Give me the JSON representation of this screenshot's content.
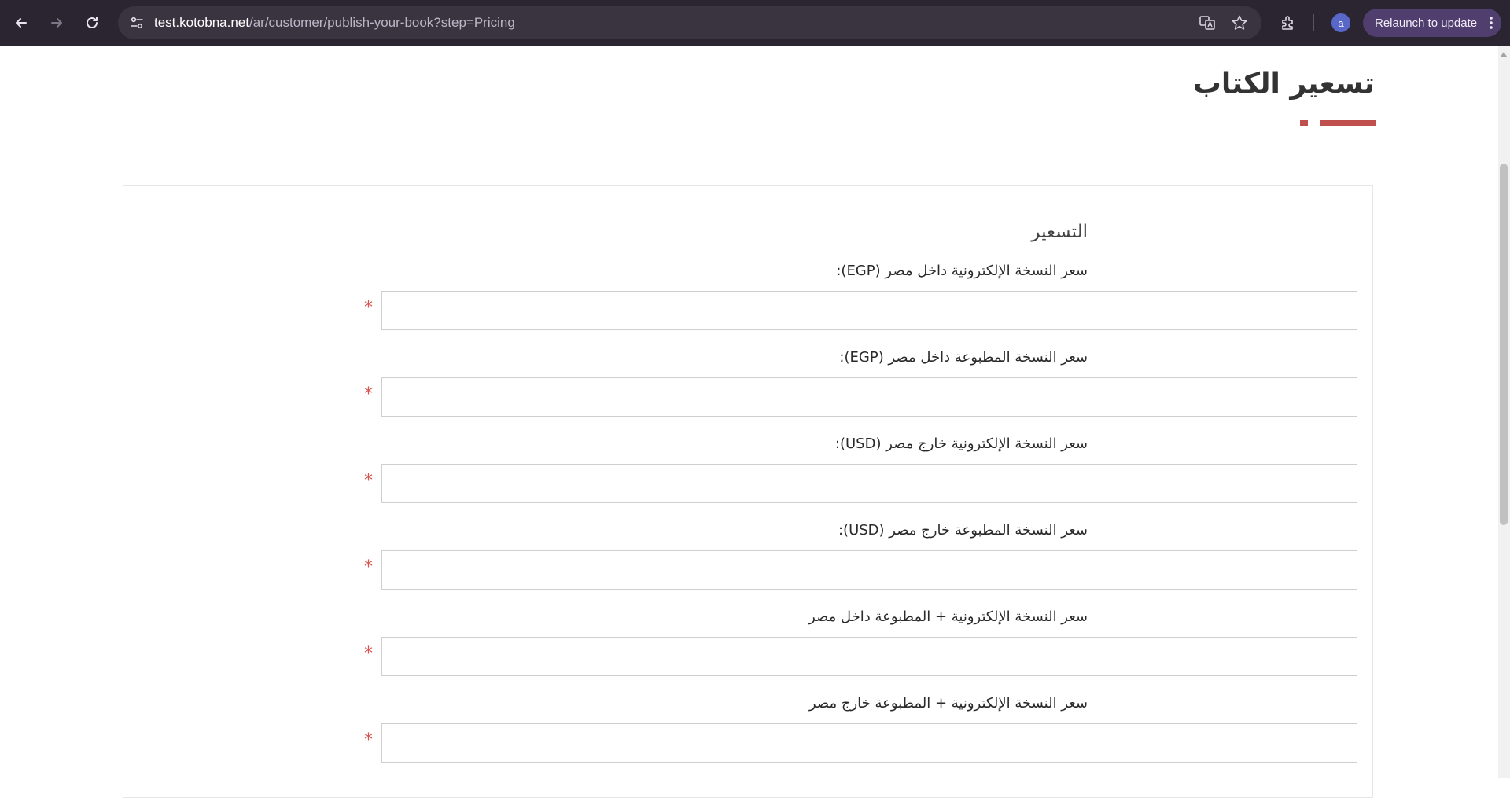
{
  "browser": {
    "url_host": "test.kotobna.net",
    "url_path": "/ar/customer/publish-your-book?step=Pricing",
    "avatar_letter": "a",
    "relaunch_label": "Relaunch to update"
  },
  "page": {
    "title": "تسعير الكتاب",
    "accent_color": "#c0504d",
    "section_title": "التسعير",
    "required_mark": "*",
    "fields": [
      {
        "label": "سعر النسخة الإلكترونية داخل مصر (EGP):",
        "value": ""
      },
      {
        "label": "سعر النسخة المطبوعة داخل مصر (EGP):",
        "value": ""
      },
      {
        "label": "سعر النسخة الإلكترونية خارج مصر (USD):",
        "value": ""
      },
      {
        "label": "سعر النسخة المطبوعة خارج مصر (USD):",
        "value": ""
      },
      {
        "label": "سعر النسخة الإلكترونية + المطبوعة داخل مصر",
        "value": ""
      },
      {
        "label": "سعر النسخة الإلكترونية + المطبوعة خارج مصر",
        "value": ""
      }
    ]
  }
}
